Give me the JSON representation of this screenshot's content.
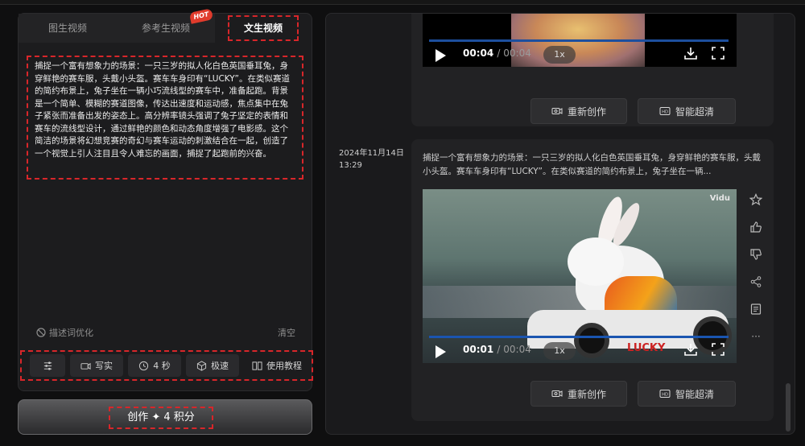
{
  "tabs": [
    {
      "label": "图生视频"
    },
    {
      "label": "参考生视频",
      "badge": "HOT"
    },
    {
      "label": "文生视频",
      "active": true
    }
  ],
  "prompt": {
    "text": "捕捉一个富有想象力的场景：一只三岁的拟人化白色英国垂耳兔，身穿鲜艳的赛车服，头戴小头盔。赛车车身印有“LUCKY”。在类似赛道的简约布景上，兔子坐在一辆小巧流线型的赛车中，准备起跑。背景是一个简单、模糊的赛道图像，传达出速度和运动感，焦点集中在兔子紧张而准备出发的姿态上。高分辨率镜头强调了兔子坚定的表情和赛车的流线型设计，通过鲜艳的颜色和动态角度增强了电影感。这个简洁的场景将幻想竞赛的奇幻与赛车运动的刺激结合在一起，创造了一个视觉上引人注目且令人难忘的画面，捕捉了起跑前的兴奋。",
    "optimize_label": "描述词优化",
    "clear_label": "清空"
  },
  "toolbar": {
    "settings_icon": "sliders-icon",
    "style_label": "写实",
    "duration_label": "4 秒",
    "speed_label": "极速",
    "tutorial_label": "使用教程"
  },
  "create": {
    "label": "创作 ✦ 4 积分"
  },
  "results": [
    {
      "video": {
        "time": "00:04",
        "total": "00:04",
        "speed": "1x"
      },
      "buttons": {
        "recreate": "重新创作",
        "upscale": "智能超清"
      }
    },
    {
      "date": "2024年11月14日",
      "time_of_day": "13:29",
      "description": "捕捉一个富有想象力的场景：一只三岁的拟人化白色英国垂耳兔，身穿鲜艳的赛车服，头戴小头盔。赛车车身印有“LUCKY”。在类似赛道的简约布景上，兔子坐在一辆...",
      "video": {
        "time": "00:01",
        "total": "00:04",
        "speed": "1x",
        "watermark": "Vidu",
        "kart_text": "LUCKY"
      },
      "buttons": {
        "recreate": "重新创作",
        "upscale": "智能超清"
      }
    }
  ],
  "colors": {
    "accent_dashed": "#d8262a",
    "progress": "#1d4f9e"
  }
}
